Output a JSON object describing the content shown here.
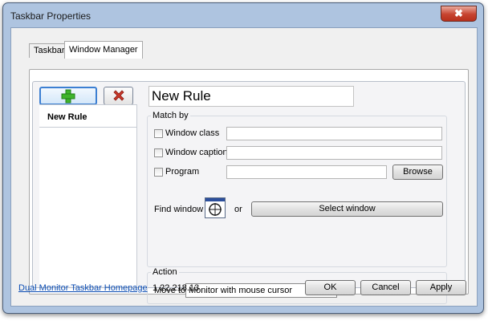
{
  "window": {
    "title": "Taskbar Properties",
    "close_glyph": "✖"
  },
  "tabs": [
    {
      "label": "Taskbar"
    },
    {
      "label": "Window Manager"
    }
  ],
  "toolbar": {
    "add_icon": "plus-icon",
    "remove_icon": "delete-x-icon",
    "add_color": "#3fb52c",
    "remove_color": "#c8382a"
  },
  "rules": [
    {
      "label": "New Rule"
    }
  ],
  "rule": {
    "name_value": "New Rule",
    "match_by": {
      "legend": "Match by",
      "window_class": {
        "label": "Window class",
        "checked": false,
        "value": ""
      },
      "window_caption": {
        "label": "Window caption",
        "checked": false,
        "value": ""
      },
      "program": {
        "label": "Program",
        "checked": false,
        "value": ""
      },
      "browse_label": "Browse",
      "find_window_label": "Find window",
      "or_label": "or",
      "select_window_label": "Select window"
    },
    "action": {
      "legend": "Action",
      "move_to_label": "Move to",
      "move_to_value": "Monitor with mouse cursor"
    }
  },
  "footer": {
    "homepage_link": "Dual Monitor Taskbar Homepage",
    "version": "1.22.218.13",
    "ok_label": "OK",
    "cancel_label": "Cancel",
    "apply_label": "Apply"
  }
}
